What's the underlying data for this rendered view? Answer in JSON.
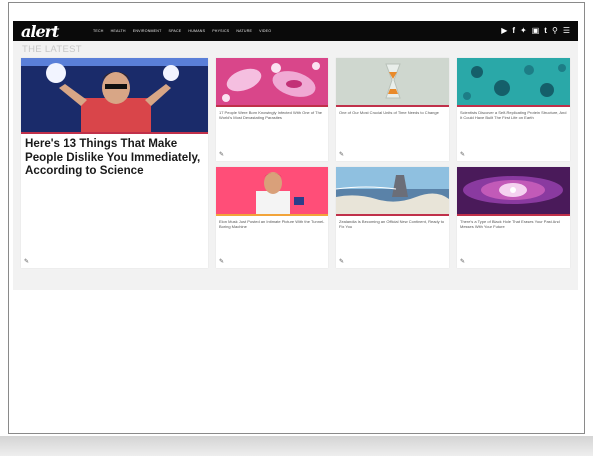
{
  "navbar": {
    "logo": "alert",
    "links": [
      "TECH",
      "HEALTH",
      "ENVIRONMENT",
      "SPACE",
      "HUMANS",
      "PHYSICS",
      "NATURE",
      "VIDEO"
    ],
    "icons": [
      "youtube-icon",
      "facebook-icon",
      "twitter-icon",
      "instagram-icon",
      "tumblr-icon",
      "search-icon",
      "menu-icon"
    ]
  },
  "section": {
    "title": "THE LATEST"
  },
  "featured": {
    "title": "Here's 13 Things That Make People Dislike You Immediately, According to Science",
    "author": "",
    "accent": "#c0304a"
  },
  "cards": [
    {
      "title": "17 People Were Born Knowingly Infected With One of The World's Most Devastating Parasites",
      "accent": "#c0304a",
      "time": ""
    },
    {
      "title": "One of Our Most Crucial Units of Time Needs to Change",
      "accent": "#c0304a",
      "time": ""
    },
    {
      "title": "Scientists Discover a Self-Replicating Protein Structure, And It Could Have Built The First Life on Earth",
      "accent": "#c0304a",
      "time": ""
    },
    {
      "title": "Elon Musk Just Posted an Intimate Picture With the Tunnel-Boring Machine",
      "accent": "#f2a43a",
      "time": ""
    },
    {
      "title": "Zealandia Is Becoming an Official New Continent, Ready to Fix You",
      "accent": "#c0304a",
      "time": ""
    },
    {
      "title": "There's a Type of Black Hole That Erases Your Past And Messes With Your Future",
      "accent": "#c0304a",
      "time": ""
    }
  ]
}
